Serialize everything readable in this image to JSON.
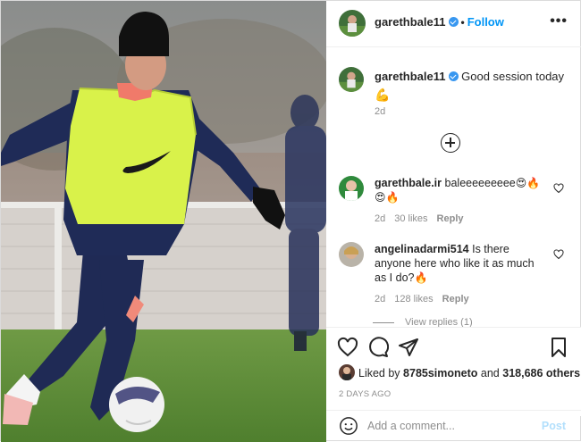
{
  "post": {
    "author": "garethbale11",
    "follow_label": "Follow",
    "more_icon": "more-options-icon",
    "more_glyph": "•••",
    "separator": "•",
    "caption_text": "Good session today",
    "caption_emoji": "💪",
    "caption_time": "2d"
  },
  "comments": [
    {
      "user": "garethbale.ir",
      "text": "baleeeeeeeee",
      "emojis_inline": "😍🔥",
      "emojis_line2": "😍🔥",
      "time": "2d",
      "likes": "30 likes",
      "reply_label": "Reply"
    },
    {
      "user": "angelinadarmi514",
      "text_line1": "Is there",
      "text_line2": "anyone here who like it as much",
      "text_line3": "as I do?",
      "emoji": "🔥",
      "time": "2d",
      "likes": "128 likes",
      "reply_label": "Reply"
    }
  ],
  "view_replies": "View replies (1)",
  "likes_summary": {
    "prefix": "Liked by",
    "user": "8785simoneto",
    "middle": "and",
    "others": "318,686 others"
  },
  "timestamp": "2 DAYS AGO",
  "add_comment": {
    "placeholder": "Add a comment...",
    "post_label": "Post"
  },
  "colors": {
    "accent": "#0095f6",
    "verified": "#3897f0",
    "muted": "#8e8e8e",
    "bib": "#d9f24a"
  }
}
